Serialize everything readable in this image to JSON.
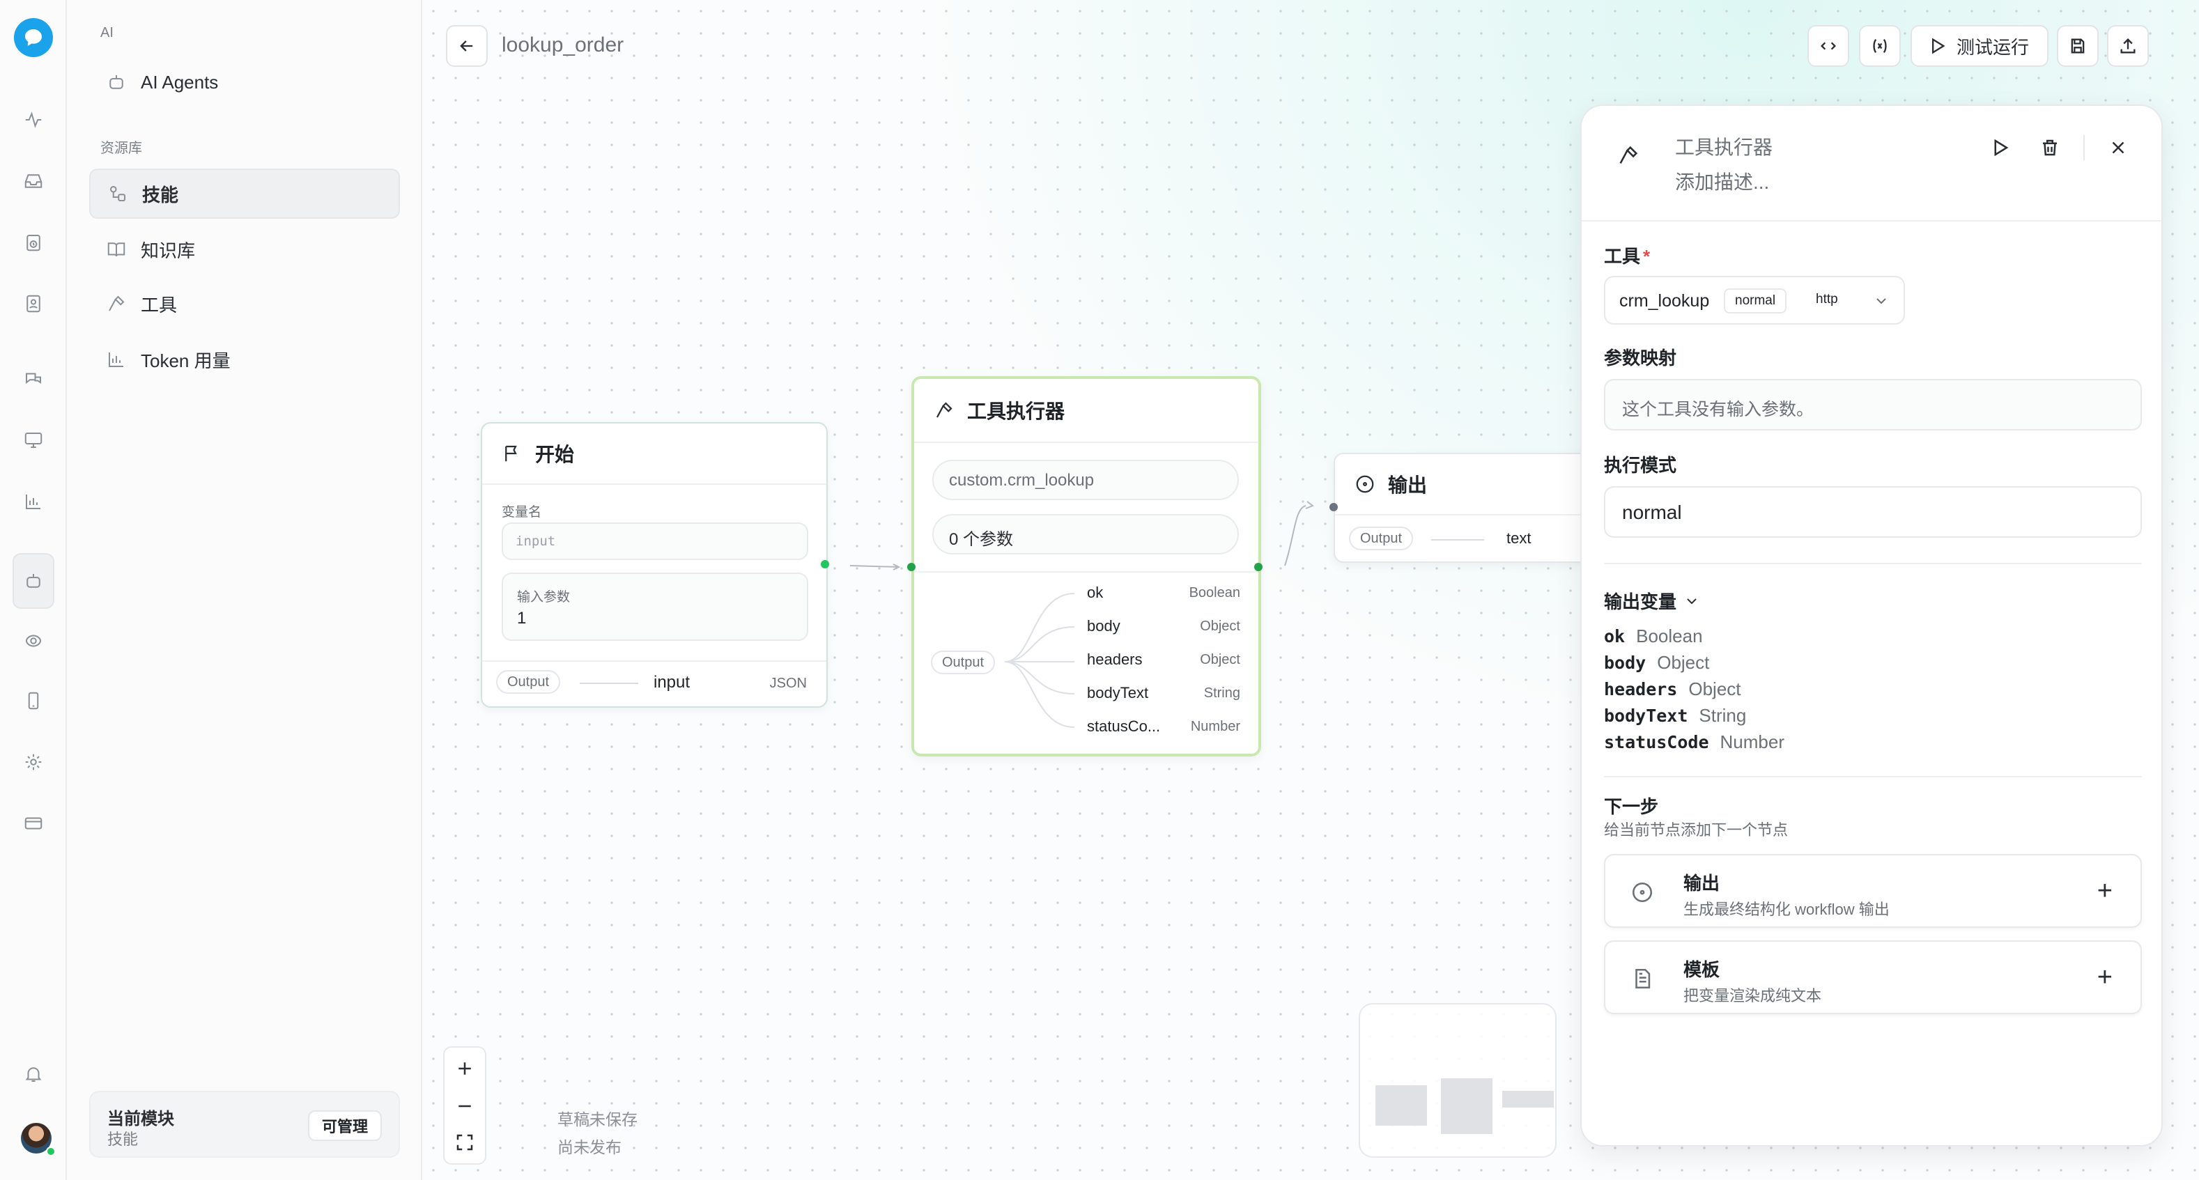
{
  "sidebar": {
    "group_ai": "AI",
    "ai_agents": "AI Agents",
    "group_resources": "资源库",
    "items": [
      {
        "label": "技能"
      },
      {
        "label": "知识库"
      },
      {
        "label": "工具"
      },
      {
        "label": "Token 用量"
      }
    ],
    "footer": {
      "title": "当前模块",
      "subtitle": "技能",
      "button": "可管理"
    }
  },
  "workflow": {
    "title": "lookup_order",
    "run_label": "测试运行",
    "draft_status": "草稿未保存",
    "publish_status": "尚未发布"
  },
  "nodes": {
    "start": {
      "title": "开始",
      "var_label": "变量名",
      "var_placeholder": "input",
      "param_label": "输入参数",
      "param_value": "1",
      "output_badge": "Output",
      "output_name": "input",
      "output_type": "JSON"
    },
    "tool": {
      "title": "工具执行器",
      "tool_id": "custom.crm_lookup",
      "param_count": "0 个参数",
      "output_badge": "Output",
      "outputs": [
        {
          "name": "ok",
          "type": "Boolean"
        },
        {
          "name": "body",
          "type": "Object"
        },
        {
          "name": "headers",
          "type": "Object"
        },
        {
          "name": "bodyText",
          "type": "String"
        },
        {
          "name": "statusCo...",
          "type": "Number"
        }
      ]
    },
    "output": {
      "title": "输出",
      "output_badge": "Output",
      "output_name": "text"
    }
  },
  "panel": {
    "title": "工具执行器",
    "description_placeholder": "添加描述...",
    "tool_label": "工具",
    "required_mark": "*",
    "tool_name": "crm_lookup",
    "tool_tag_mode": "normal",
    "tool_tag_type": "http",
    "param_mapping_label": "参数映射",
    "param_mapping_empty": "这个工具没有输入参数。",
    "exec_mode_label": "执行模式",
    "exec_mode_value": "normal",
    "output_vars_label": "输出变量",
    "output_vars": [
      {
        "name": "ok",
        "type": "Boolean"
      },
      {
        "name": "body",
        "type": "Object"
      },
      {
        "name": "headers",
        "type": "Object"
      },
      {
        "name": "bodyText",
        "type": "String"
      },
      {
        "name": "statusCode",
        "type": "Number"
      }
    ],
    "next_label": "下一步",
    "next_hint": "给当前节点添加下一个节点",
    "next_options": [
      {
        "title": "输出",
        "desc": "生成最终结构化 workflow 输出"
      },
      {
        "title": "模板",
        "desc": "把变量渲染成纯文本"
      }
    ]
  },
  "colors": {
    "accent": "#1aa2ea",
    "tool_node_border": "#c9e8b0",
    "connector_green": "#22a34a"
  }
}
